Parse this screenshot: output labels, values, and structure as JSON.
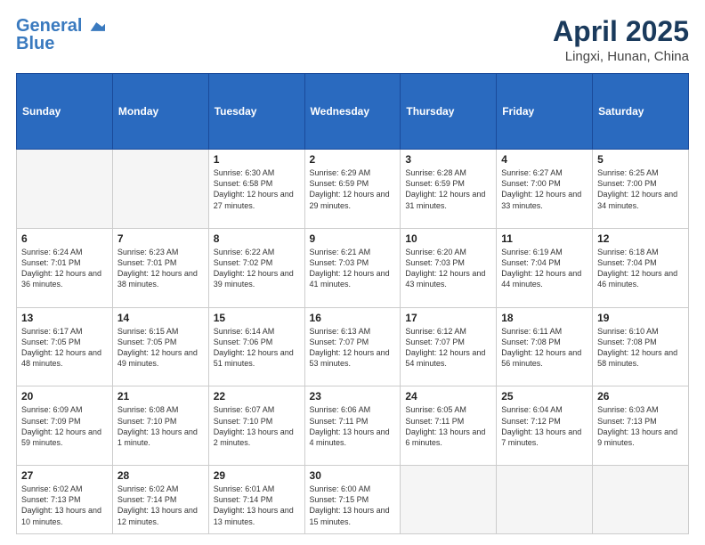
{
  "logo": {
    "line1": "General",
    "line2": "Blue"
  },
  "title": {
    "month": "April 2025",
    "location": "Lingxi, Hunan, China"
  },
  "headers": [
    "Sunday",
    "Monday",
    "Tuesday",
    "Wednesday",
    "Thursday",
    "Friday",
    "Saturday"
  ],
  "weeks": [
    [
      {
        "day": "",
        "info": ""
      },
      {
        "day": "",
        "info": ""
      },
      {
        "day": "1",
        "info": "Sunrise: 6:30 AM\nSunset: 6:58 PM\nDaylight: 12 hours and 27 minutes."
      },
      {
        "day": "2",
        "info": "Sunrise: 6:29 AM\nSunset: 6:59 PM\nDaylight: 12 hours and 29 minutes."
      },
      {
        "day": "3",
        "info": "Sunrise: 6:28 AM\nSunset: 6:59 PM\nDaylight: 12 hours and 31 minutes."
      },
      {
        "day": "4",
        "info": "Sunrise: 6:27 AM\nSunset: 7:00 PM\nDaylight: 12 hours and 33 minutes."
      },
      {
        "day": "5",
        "info": "Sunrise: 6:25 AM\nSunset: 7:00 PM\nDaylight: 12 hours and 34 minutes."
      }
    ],
    [
      {
        "day": "6",
        "info": "Sunrise: 6:24 AM\nSunset: 7:01 PM\nDaylight: 12 hours and 36 minutes."
      },
      {
        "day": "7",
        "info": "Sunrise: 6:23 AM\nSunset: 7:01 PM\nDaylight: 12 hours and 38 minutes."
      },
      {
        "day": "8",
        "info": "Sunrise: 6:22 AM\nSunset: 7:02 PM\nDaylight: 12 hours and 39 minutes."
      },
      {
        "day": "9",
        "info": "Sunrise: 6:21 AM\nSunset: 7:03 PM\nDaylight: 12 hours and 41 minutes."
      },
      {
        "day": "10",
        "info": "Sunrise: 6:20 AM\nSunset: 7:03 PM\nDaylight: 12 hours and 43 minutes."
      },
      {
        "day": "11",
        "info": "Sunrise: 6:19 AM\nSunset: 7:04 PM\nDaylight: 12 hours and 44 minutes."
      },
      {
        "day": "12",
        "info": "Sunrise: 6:18 AM\nSunset: 7:04 PM\nDaylight: 12 hours and 46 minutes."
      }
    ],
    [
      {
        "day": "13",
        "info": "Sunrise: 6:17 AM\nSunset: 7:05 PM\nDaylight: 12 hours and 48 minutes."
      },
      {
        "day": "14",
        "info": "Sunrise: 6:15 AM\nSunset: 7:05 PM\nDaylight: 12 hours and 49 minutes."
      },
      {
        "day": "15",
        "info": "Sunrise: 6:14 AM\nSunset: 7:06 PM\nDaylight: 12 hours and 51 minutes."
      },
      {
        "day": "16",
        "info": "Sunrise: 6:13 AM\nSunset: 7:07 PM\nDaylight: 12 hours and 53 minutes."
      },
      {
        "day": "17",
        "info": "Sunrise: 6:12 AM\nSunset: 7:07 PM\nDaylight: 12 hours and 54 minutes."
      },
      {
        "day": "18",
        "info": "Sunrise: 6:11 AM\nSunset: 7:08 PM\nDaylight: 12 hours and 56 minutes."
      },
      {
        "day": "19",
        "info": "Sunrise: 6:10 AM\nSunset: 7:08 PM\nDaylight: 12 hours and 58 minutes."
      }
    ],
    [
      {
        "day": "20",
        "info": "Sunrise: 6:09 AM\nSunset: 7:09 PM\nDaylight: 12 hours and 59 minutes."
      },
      {
        "day": "21",
        "info": "Sunrise: 6:08 AM\nSunset: 7:10 PM\nDaylight: 13 hours and 1 minute."
      },
      {
        "day": "22",
        "info": "Sunrise: 6:07 AM\nSunset: 7:10 PM\nDaylight: 13 hours and 2 minutes."
      },
      {
        "day": "23",
        "info": "Sunrise: 6:06 AM\nSunset: 7:11 PM\nDaylight: 13 hours and 4 minutes."
      },
      {
        "day": "24",
        "info": "Sunrise: 6:05 AM\nSunset: 7:11 PM\nDaylight: 13 hours and 6 minutes."
      },
      {
        "day": "25",
        "info": "Sunrise: 6:04 AM\nSunset: 7:12 PM\nDaylight: 13 hours and 7 minutes."
      },
      {
        "day": "26",
        "info": "Sunrise: 6:03 AM\nSunset: 7:13 PM\nDaylight: 13 hours and 9 minutes."
      }
    ],
    [
      {
        "day": "27",
        "info": "Sunrise: 6:02 AM\nSunset: 7:13 PM\nDaylight: 13 hours and 10 minutes."
      },
      {
        "day": "28",
        "info": "Sunrise: 6:02 AM\nSunset: 7:14 PM\nDaylight: 13 hours and 12 minutes."
      },
      {
        "day": "29",
        "info": "Sunrise: 6:01 AM\nSunset: 7:14 PM\nDaylight: 13 hours and 13 minutes."
      },
      {
        "day": "30",
        "info": "Sunrise: 6:00 AM\nSunset: 7:15 PM\nDaylight: 13 hours and 15 minutes."
      },
      {
        "day": "",
        "info": ""
      },
      {
        "day": "",
        "info": ""
      },
      {
        "day": "",
        "info": ""
      }
    ]
  ]
}
